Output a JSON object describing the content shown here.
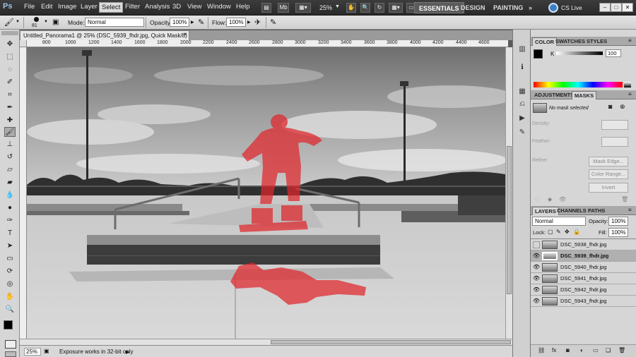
{
  "app": {
    "logo": "Ps"
  },
  "menubar": {
    "items": [
      "File",
      "Edit",
      "Image",
      "Layer",
      "Select",
      "Filter",
      "Analysis",
      "3D",
      "View",
      "Window",
      "Help"
    ],
    "zoom": "25%",
    "workspaces": [
      "ESSENTIALS",
      "DESIGN",
      "PAINTING"
    ],
    "more": "»",
    "cslive": "CS Live",
    "win_min": "–",
    "win_max": "□",
    "win_close": "✕"
  },
  "options": {
    "brush_size": "81",
    "mode_label": "Mode:",
    "mode_value": "Normal",
    "opacity_label": "Opacity:",
    "opacity_value": "100%",
    "flow_label": "Flow:",
    "flow_value": "100%"
  },
  "document": {
    "tab_title": "Untitled_Panorama1 @ 25% (DSC_5939_fhdr.jpg, Quick Mask/8) *",
    "ruler_ticks": [
      "800",
      "1000",
      "1200",
      "1400",
      "1600",
      "1800",
      "2000",
      "2200",
      "2400",
      "2600",
      "2800",
      "3000",
      "3200",
      "3400",
      "3600",
      "3800",
      "4000",
      "4200",
      "4400",
      "4600"
    ],
    "status_zoom": "25%",
    "status_text": "Exposure works in 32-bit only"
  },
  "panels": {
    "color_tabs": [
      "COLOR",
      "SWATCHES",
      "STYLES"
    ],
    "color_channel": "K",
    "color_value": "100",
    "adjust_tabs": [
      "ADJUSTMENTS",
      "MASKS"
    ],
    "no_mask": "No mask selected",
    "density_label": "Density:",
    "feather_label": "Feather:",
    "refine_label": "Refine:",
    "mask_edge": "Mask Edge...",
    "color_range": "Color Range...",
    "invert": "Invert",
    "layer_tabs": [
      "LAYERS",
      "CHANNELS",
      "PATHS"
    ],
    "blend_mode": "Normal",
    "opacity_label": "Opacity:",
    "opacity_value": "100%",
    "lock_label": "Lock:",
    "fill_label": "Fill:",
    "fill_value": "100%",
    "layers": [
      {
        "name": "DSC_5938_fhdr.jpg",
        "visible": false,
        "selected": false
      },
      {
        "name": "DSC_5939_fhdr.jpg",
        "visible": true,
        "selected": true
      },
      {
        "name": "DSC_5940_fhdr.jpg",
        "visible": true,
        "selected": false
      },
      {
        "name": "DSC_5941_fhdr.jpg",
        "visible": true,
        "selected": false
      },
      {
        "name": "DSC_5942_fhdr.jpg",
        "visible": true,
        "selected": false
      },
      {
        "name": "DSC_5943_fhdr.jpg",
        "visible": true,
        "selected": false
      }
    ]
  },
  "colors": {
    "quickmask": "#e0262b",
    "swatch_fg": "#000000",
    "swatch_bg": "#ffffff"
  }
}
